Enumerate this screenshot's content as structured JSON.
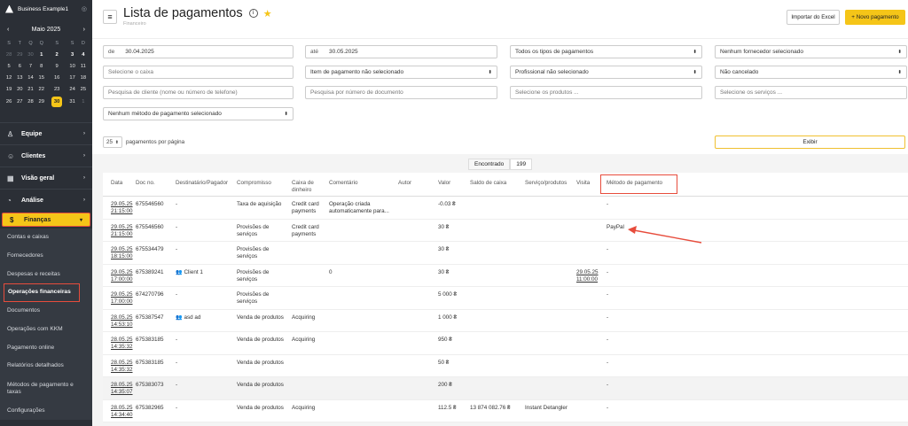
{
  "sidebar": {
    "business": "Business Example1",
    "calendar": {
      "month": "Maio 2025",
      "prev": "‹",
      "next": "›",
      "weekdays": [
        "S",
        "T",
        "Q",
        "Q",
        "S",
        "S",
        "D"
      ],
      "rows": [
        [
          "28",
          "29",
          "30",
          "1",
          "2",
          "3",
          "4"
        ],
        [
          "5",
          "6",
          "7",
          "8",
          "9",
          "10",
          "11"
        ],
        [
          "12",
          "13",
          "14",
          "15",
          "16",
          "17",
          "18"
        ],
        [
          "19",
          "20",
          "21",
          "22",
          "23",
          "24",
          "25"
        ],
        [
          "26",
          "27",
          "28",
          "29",
          "30",
          "31",
          "1"
        ]
      ]
    },
    "nav": {
      "equipe": "Equipe",
      "clientes": "Clientes",
      "visao": "Visão geral",
      "analise": "Análise",
      "financas": "Finanças"
    },
    "sub": [
      "Contas e caixas",
      "Fornecedores",
      "Despesas e receitas",
      "Operações financeiras",
      "Documentos",
      "Operações com KKM",
      "Pagamento online",
      "Relatórios detalhados",
      "Métodos de pagamento e taxas",
      "Configurações"
    ]
  },
  "header": {
    "title": "Lista de pagamentos",
    "subtitle": "Financeiro",
    "info": "i",
    "star": "★",
    "menu": "≡",
    "import_excel": "Importar do Excel",
    "new_payment": "+  Novo pagamento"
  },
  "filters": {
    "from_label": "de",
    "from_value": "30.04.2025",
    "to_label": "até",
    "to_value": "30.05.2025",
    "payment_types": "Todos os tipos de pagamentos",
    "supplier": "Nenhum fornecedor selecionado",
    "cash_ph": "Selecione o caixa",
    "payment_item": "Item de pagamento não selecionado",
    "professional": "Profissional não selecionado",
    "cancelled": "Não cancelado",
    "client_search_ph": "Pesquisa de cliente (nome ou número de telefone)",
    "doc_search_ph": "Pesquisa por número de documento",
    "products_ph": "Selecione os produtos ...",
    "services_ph": "Selecione os serviços ...",
    "payment_method": "Nenhum método de pagamento selecionado"
  },
  "pagination": {
    "per_page_value": "25",
    "per_page_label": "pagamentos por página",
    "show_button": "Exibir"
  },
  "found": {
    "label": "Encontrado",
    "count": "199"
  },
  "table": {
    "columns": [
      "Data",
      "Doc no.",
      "Destinatário/Pagador",
      "Compromisso",
      "Caixa de dinheiro",
      "Comentário",
      "Autor",
      "Valor",
      "Saldo de caixa",
      "Serviço/produtos",
      "Visita",
      "Método de pagamento"
    ],
    "rows": [
      {
        "date": "29.05.25 21:15:00",
        "doc": "675546560",
        "payer": "-",
        "commit": "Taxa de aquisição",
        "cash": "Credit card payments",
        "comment": "Operação criada automaticamente para...",
        "author": "",
        "value": "-0.03 ₴",
        "balance": "",
        "service": "",
        "visit": "",
        "method": "-"
      },
      {
        "date": "29.05.25 21:15:00",
        "doc": "675546560",
        "payer": "-",
        "commit": "Provisões de serviços",
        "cash": "Credit card payments",
        "comment": "",
        "author": "",
        "value": "30 ₴",
        "balance": "",
        "service": "",
        "visit": "",
        "method": "PayPal"
      },
      {
        "date": "29.05.25 18:15:00",
        "doc": "675534479",
        "payer": "-",
        "commit": "Provisões de serviços",
        "cash": "",
        "comment": "",
        "author": "",
        "value": "30 ₴",
        "balance": "",
        "service": "",
        "visit": "",
        "method": "-"
      },
      {
        "date": "29.05.25 17:00:00",
        "doc": "675389241",
        "payer": "Client 1",
        "commit": "Provisões de serviços",
        "cash": "",
        "comment": "0",
        "author": "",
        "value": "30 ₴",
        "balance": "",
        "service": "",
        "visit": "29.05.25 11:00:00",
        "method": "-"
      },
      {
        "date": "29.05.25 17:00:00",
        "doc": "674270796",
        "payer": "-",
        "commit": "Provisões de serviços",
        "cash": "",
        "comment": "",
        "author": "",
        "value": "5 000 ₴",
        "balance": "",
        "service": "",
        "visit": "",
        "method": "-"
      },
      {
        "date": "28.05.25 14:53:10",
        "doc": "675387547",
        "payer": "asd ad",
        "commit": "Venda de produtos",
        "cash": "Acquiring",
        "comment": "",
        "author": "",
        "value": "1 000 ₴",
        "balance": "",
        "service": "",
        "visit": "",
        "method": "-"
      },
      {
        "date": "28.05.25 14:35:32",
        "doc": "675383185",
        "payer": "-",
        "commit": "Venda de produtos",
        "cash": "Acquiring",
        "comment": "",
        "author": "",
        "value": "950 ₴",
        "balance": "",
        "service": "",
        "visit": "",
        "method": "-"
      },
      {
        "date": "28.05.25 14:35:32",
        "doc": "675383185",
        "payer": "-",
        "commit": "Venda de produtos",
        "cash": "",
        "comment": "",
        "author": "",
        "value": "50 ₴",
        "balance": "",
        "service": "",
        "visit": "",
        "method": "-"
      },
      {
        "date": "28.05.25 14:35:07",
        "doc": "675383073",
        "payer": "-",
        "commit": "Venda de produtos",
        "cash": "",
        "comment": "",
        "author": "",
        "value": "200 ₴",
        "balance": "",
        "service": "",
        "visit": "",
        "method": "-"
      },
      {
        "date": "28.05.25 14:34:40",
        "doc": "675382965",
        "payer": "-",
        "commit": "Venda de produtos",
        "cash": "Acquiring",
        "comment": "",
        "author": "",
        "value": "112.5 ₴",
        "balance": "13 874 082.76 ₴",
        "service": "Instant Detangler",
        "visit": "",
        "method": "-"
      }
    ]
  },
  "colors": {
    "accent": "#f5c518",
    "highlight": "#e74c3c",
    "sidebar": "#2b2f36"
  }
}
